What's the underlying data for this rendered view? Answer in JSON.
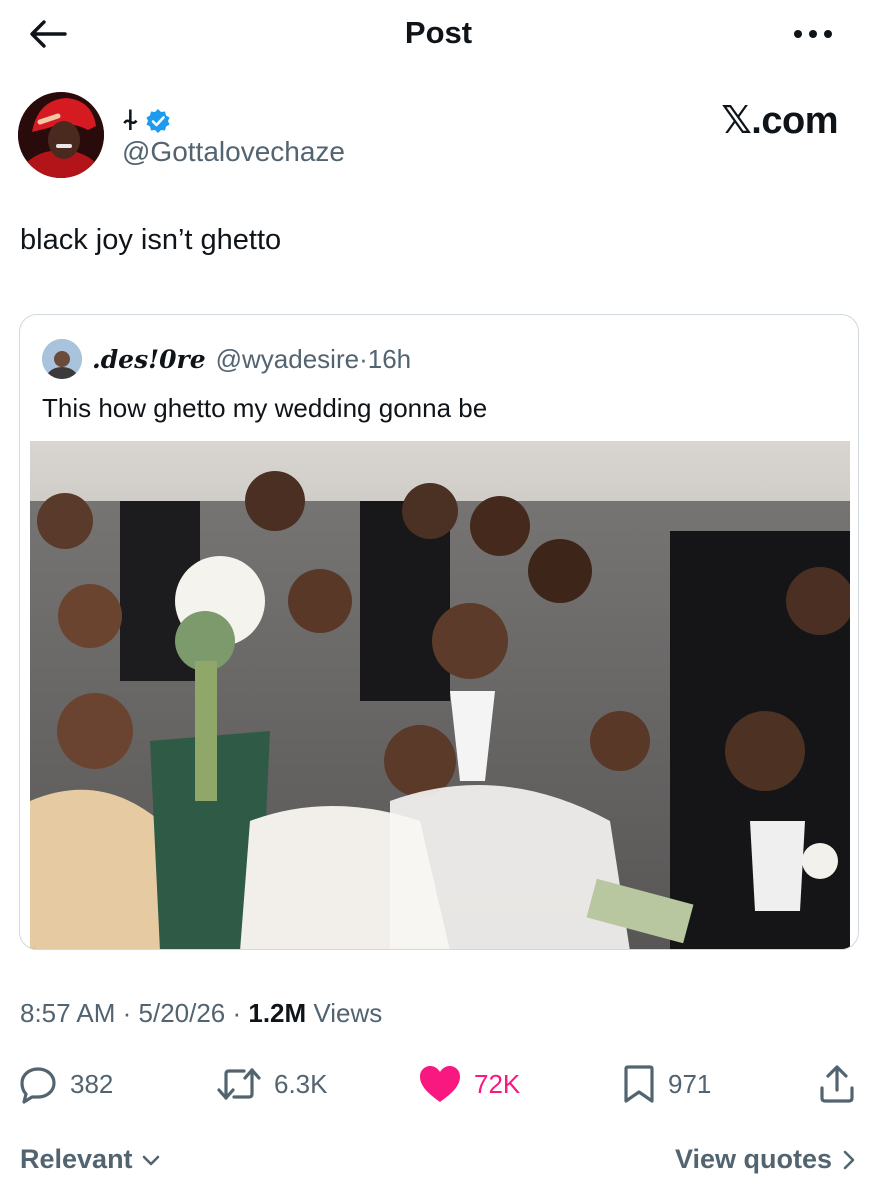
{
  "header": {
    "title": "Post",
    "back_icon": "arrow-left-icon",
    "more_icon": "more-horizontal-icon"
  },
  "author": {
    "display_name": "⍭",
    "verified": true,
    "handle": "@Gottalovechaze",
    "watermark": "𝕏.com"
  },
  "tweet": {
    "text": "black joy isn’t ghetto"
  },
  "quote": {
    "name": ".des!0re",
    "handle": "@wyadesire",
    "separator": " · ",
    "time": "16h",
    "text": "This how ghetto my wedding gonna be",
    "media_description_icon": "photo"
  },
  "meta": {
    "time": "8:57 AM",
    "sep1": " · ",
    "date": "5/20/26",
    "sep2": " · ",
    "views_count": "1.2M",
    "views_label": " Views"
  },
  "actions": {
    "replies": "382",
    "reposts": "6.3K",
    "likes": "72K",
    "bookmarks": "971"
  },
  "footer": {
    "sort_label": "Relevant",
    "view_quotes_label": "View quotes"
  },
  "colors": {
    "like": "#f91880",
    "verified": "#1d9bf0",
    "muted": "#536471",
    "text": "#0f1419"
  }
}
